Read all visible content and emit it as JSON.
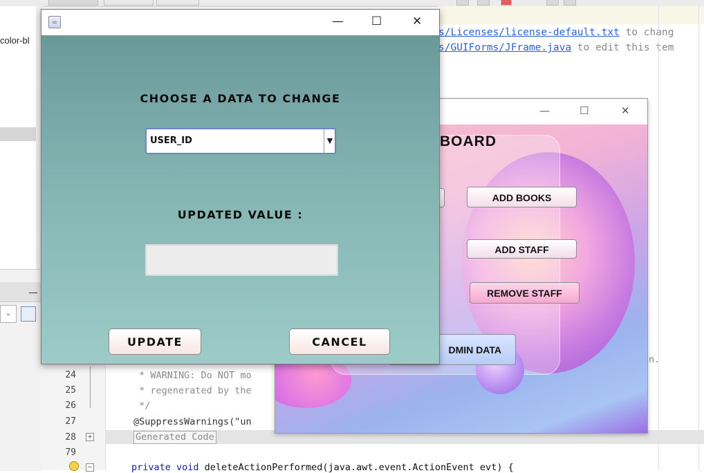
{
  "ide": {
    "left_fragment": "color-bl",
    "header_lines": [
      {
        "link": "s/Licenses/license-default.txt",
        "rest": " to chang"
      },
      {
        "link": "s/GUIForms/JFrame.java",
        "rest": " to edit this tem"
      }
    ],
    "line_numbers": [
      "24",
      "25",
      "26",
      "27",
      "28",
      "79"
    ],
    "code_lines": [
      " * WARNING: Do NOT mo",
      " * regenerated by the",
      " */",
      "@SuppressWarnings(\"un"
    ],
    "generated_code": "Generated Code",
    "last_line_keywords": "private void",
    "last_line_rest": " deleteActionPerformed(java.awt.event.ActionEvent evt) {",
    "right_fragment": "n.",
    "fold_plus": "+",
    "fold_minus": "−"
  },
  "dashboard": {
    "heading": "BOARD",
    "controls": {
      "minimize": "—",
      "maximize": "☐",
      "close": "✕"
    },
    "buttons": {
      "add_books": "ADD BOOKS",
      "add_staff": "ADD STAFF",
      "remove_staff": "REMOVE STAFF",
      "admin_data": "DMIN DATA"
    }
  },
  "dialog": {
    "controls": {
      "minimize": "—",
      "maximize": "☐",
      "close": "✕"
    },
    "choose_label": "CHOOSE A DATA TO CHANGE",
    "selected_option": "USER_ID",
    "updated_label": "UPDATED VALUE :",
    "input_value": "",
    "update_button": "UPDATE",
    "cancel_button": "CANCEL",
    "combo_arrow": "▼",
    "java_icon": "☕"
  }
}
